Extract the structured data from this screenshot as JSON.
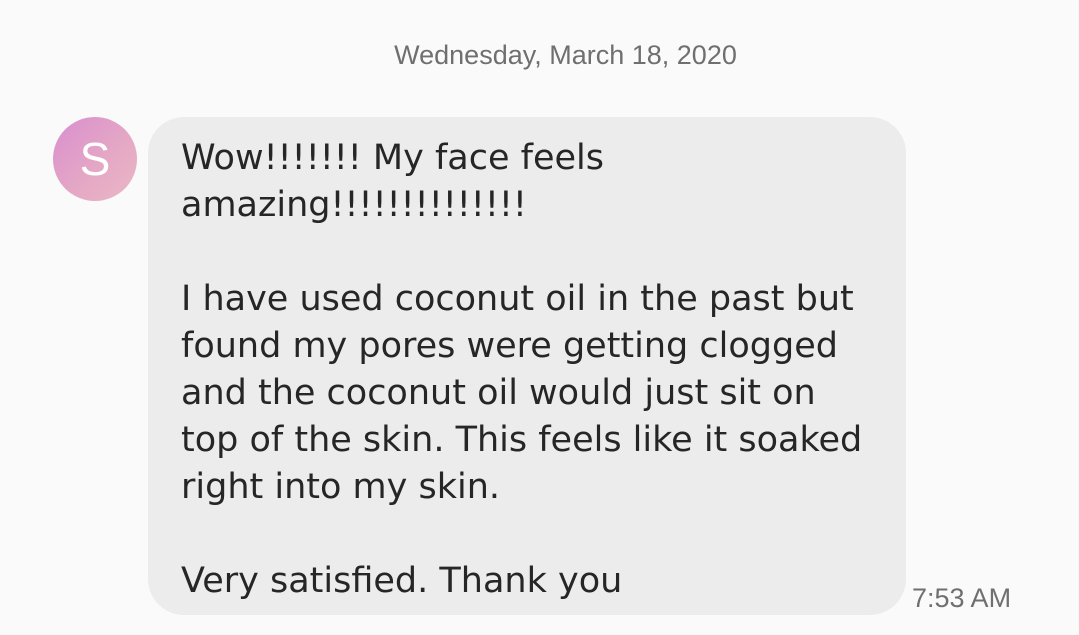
{
  "conversation": {
    "date_header": "Wednesday, March 18, 2020"
  },
  "message": {
    "sender_initial": "S",
    "paragraphs": [
      [
        "Wow!!!!!!! My face feels",
        "amazing!!!!!!!!!!!!!!"
      ],
      [
        "I have used coconut oil in the past but",
        "found my pores were getting clogged",
        "and the coconut oil would just sit on",
        "top of the skin. This feels like it soaked",
        "right into my skin."
      ],
      [
        "Very satisfied. Thank you"
      ]
    ],
    "time": "7:53 AM"
  },
  "colors": {
    "background": "#fafafa",
    "bubble": "#ececec",
    "avatar_gradient_start": "#d98ecf",
    "avatar_gradient_end": "#eab8c6",
    "text_primary": "#262626",
    "text_secondary": "#6f6f6f"
  }
}
